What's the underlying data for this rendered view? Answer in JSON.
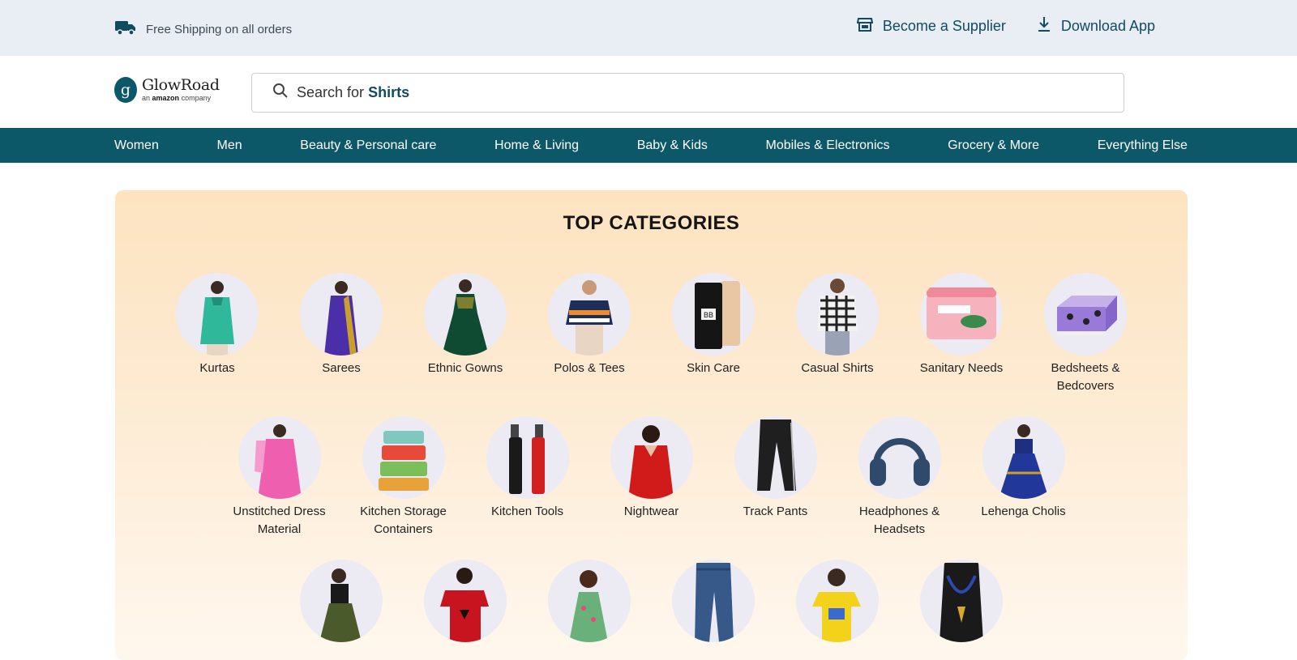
{
  "topbar": {
    "shipping_text": "Free Shipping on all orders",
    "supplier_label": "Become a Supplier",
    "download_label": "Download App"
  },
  "logo": {
    "brand": "GlowRoad",
    "tagline_pre": "an",
    "tagline_brand": "amazon",
    "tagline_post": "company"
  },
  "search": {
    "prefix": "Search for",
    "keyword": "Shirts"
  },
  "nav": [
    "Women",
    "Men",
    "Beauty & Personal care",
    "Home & Living",
    "Baby & Kids",
    "Mobiles & Electronics",
    "Grocery & More",
    "Everything Else"
  ],
  "section_title": "TOP CATEGORIES",
  "rows": [
    [
      {
        "label": "Kurtas",
        "icon": "kurta-image"
      },
      {
        "label": "Sarees",
        "icon": "saree-image"
      },
      {
        "label": "Ethnic Gowns",
        "icon": "gown-image"
      },
      {
        "label": "Polos & Tees",
        "icon": "polo-image"
      },
      {
        "label": "Skin Care",
        "icon": "skincare-tube-image"
      },
      {
        "label": "Casual Shirts",
        "icon": "checked-shirt-image"
      },
      {
        "label": "Sanitary Needs",
        "icon": "sanitary-pads-image"
      },
      {
        "label": "Bedsheets & Bedcovers",
        "icon": "bedsheet-image"
      }
    ],
    [
      {
        "label": "Unstitched Dress Material",
        "icon": "pink-dress-image"
      },
      {
        "label": "Kitchen Storage Containers",
        "icon": "containers-image"
      },
      {
        "label": "Kitchen Tools",
        "icon": "oil-bottles-image"
      },
      {
        "label": "Nightwear",
        "icon": "nightwear-image"
      },
      {
        "label": "Track Pants",
        "icon": "track-pants-image"
      },
      {
        "label": "Headphones & Headsets",
        "icon": "headphones-image"
      },
      {
        "label": "Lehenga Cholis",
        "icon": "lehenga-image"
      }
    ],
    [
      {
        "label": "",
        "icon": "dress-image"
      },
      {
        "label": "",
        "icon": "red-tee-image"
      },
      {
        "label": "",
        "icon": "kids-dress-image"
      },
      {
        "label": "",
        "icon": "jeans-image"
      },
      {
        "label": "",
        "icon": "kids-tee-image"
      },
      {
        "label": "",
        "icon": "necklace-image"
      }
    ]
  ],
  "colors": {
    "teal": "#0d5868",
    "accent_text": "#114b5f",
    "topbar_bg": "#e8eef3",
    "panel_top": "#fde3c0"
  }
}
